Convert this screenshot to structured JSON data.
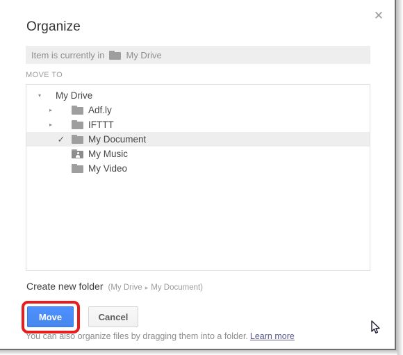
{
  "dialog": {
    "title": "Organize",
    "close_icon": "close-icon",
    "current_location": {
      "prefix": "Item is currently in",
      "folder_icon": "folder-icon",
      "folder_name": "My Drive"
    },
    "move_to_label": "MOVE TO"
  },
  "tree": {
    "root": {
      "label": "My Drive",
      "twisty": "▾",
      "expanded": true
    },
    "items": [
      {
        "label": "Adf.ly",
        "twisty": "▸",
        "icon": "folder-icon",
        "selected": false,
        "check": ""
      },
      {
        "label": "IFTTT",
        "twisty": "▸",
        "icon": "folder-icon",
        "selected": false,
        "check": ""
      },
      {
        "label": "My Document",
        "twisty": "",
        "icon": "folder-icon",
        "selected": true,
        "check": "✓"
      },
      {
        "label": "My Music",
        "twisty": "",
        "icon": "folder-shared-icon",
        "selected": false,
        "check": ""
      },
      {
        "label": "My Video",
        "twisty": "",
        "icon": "folder-icon",
        "selected": false,
        "check": ""
      }
    ]
  },
  "create_folder": {
    "link_label": "Create new folder",
    "path_open": "(My Drive",
    "path_separator": "▸",
    "path_close": "My Document)"
  },
  "buttons": {
    "move_label": "Move",
    "cancel_label": "Cancel"
  },
  "footer": {
    "note": "You can also organize files by dragging them into a folder.",
    "learn_more": "Learn more"
  },
  "colors": {
    "primary_button": "#4d90fe",
    "primary_button_border": "#3079ed",
    "highlight_ring": "#e71d1d",
    "selected_row": "#eeeeee",
    "folder_gray": "#9e9e9e",
    "muted_text": "#8d8d8d",
    "link": "#5a5a8c"
  }
}
